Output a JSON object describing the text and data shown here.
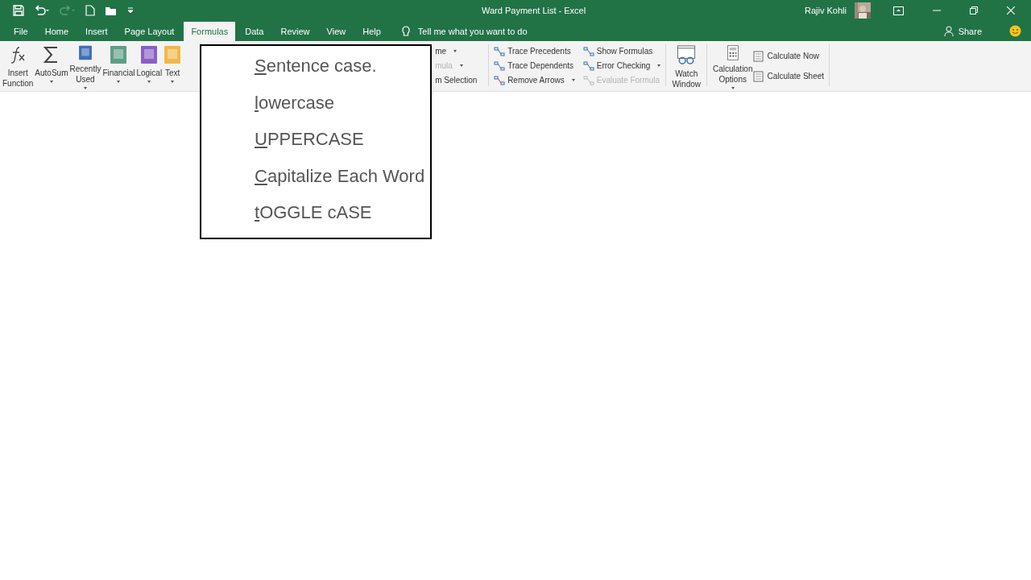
{
  "window": {
    "title": "Ward Payment List  -  Excel",
    "user": "Rajiv Kohli"
  },
  "tabs": [
    {
      "label": "File",
      "selected": false
    },
    {
      "label": "Home",
      "selected": false
    },
    {
      "label": "Insert",
      "selected": false
    },
    {
      "label": "Page Layout",
      "selected": false
    },
    {
      "label": "Formulas",
      "selected": true
    },
    {
      "label": "Data",
      "selected": false
    },
    {
      "label": "Review",
      "selected": false
    },
    {
      "label": "View",
      "selected": false
    },
    {
      "label": "Help",
      "selected": false
    }
  ],
  "tell_me": {
    "placeholder": "Tell me what you want to do"
  },
  "share": "Share",
  "function_library": [
    {
      "lines": [
        "Insert",
        "Function"
      ],
      "dropdown": false
    },
    {
      "lines": [
        "AutoSum"
      ],
      "dropdown": true
    },
    {
      "lines": [
        "Recently",
        "Used"
      ],
      "dropdown": true
    },
    {
      "lines": [
        "Financial"
      ],
      "dropdown": true
    },
    {
      "lines": [
        "Logical"
      ],
      "dropdown": true
    },
    {
      "lines": [
        "Text"
      ],
      "dropdown": true
    }
  ],
  "defined_names": [
    {
      "label": "me",
      "dropdown": true,
      "disabled": false
    },
    {
      "label": "mula",
      "dropdown": true,
      "disabled": true
    },
    {
      "label": "m Selection",
      "dropdown": false,
      "disabled": false
    }
  ],
  "formula_auditing": [
    {
      "label": "Trace Precedents",
      "dropdown": false,
      "disabled": false
    },
    {
      "label": "Trace Dependents",
      "dropdown": false,
      "disabled": false
    },
    {
      "label": "Remove Arrows",
      "dropdown": true,
      "disabled": false
    },
    {
      "label": "Show Formulas",
      "dropdown": false,
      "disabled": false
    },
    {
      "label": "Error Checking",
      "dropdown": true,
      "disabled": false
    },
    {
      "label": "Evaluate Formula",
      "dropdown": false,
      "disabled": true
    }
  ],
  "watch_window": {
    "lines": [
      "Watch",
      "Window"
    ]
  },
  "calculation": {
    "options": {
      "lines": [
        "Calculation",
        "Options"
      ],
      "dropdown": true
    },
    "actions": [
      "Calculate Now",
      "Calculate Sheet"
    ]
  },
  "change_case_menu": [
    "Sentence case.",
    "lowercase",
    "UPPERCASE",
    "Capitalize Each Word",
    "tOGGLE cASE"
  ]
}
